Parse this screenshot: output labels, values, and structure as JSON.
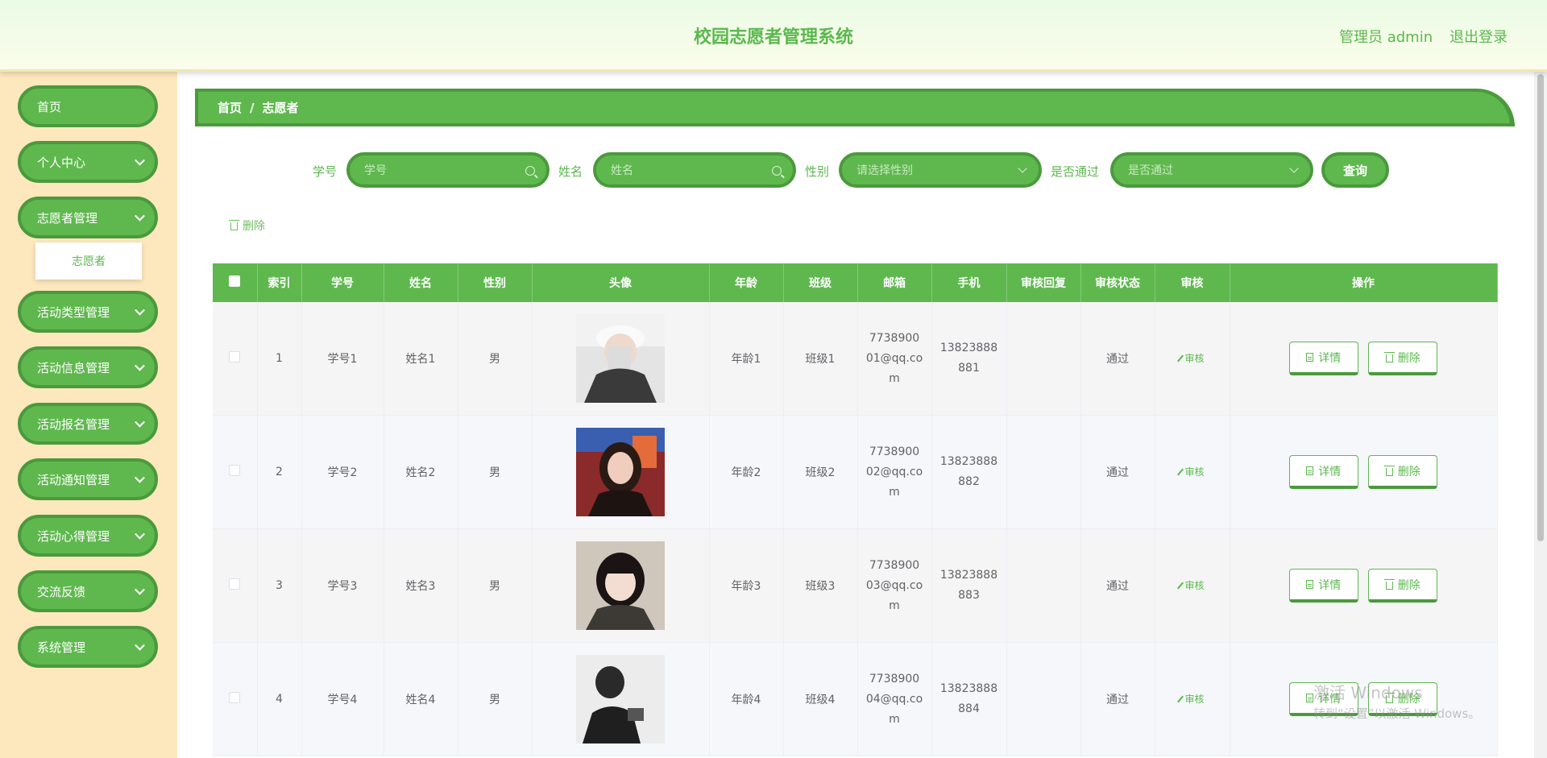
{
  "header": {
    "title": "校园志愿者管理系统",
    "user": "管理员 admin",
    "logout": "退出登录"
  },
  "sidebar": {
    "items": [
      {
        "label": "首页"
      },
      {
        "label": "个人中心"
      },
      {
        "label": "志愿者管理"
      },
      {
        "label": "活动类型管理"
      },
      {
        "label": "活动信息管理"
      },
      {
        "label": "活动报名管理"
      },
      {
        "label": "活动通知管理"
      },
      {
        "label": "活动心得管理"
      },
      {
        "label": "交流反馈"
      },
      {
        "label": "系统管理"
      }
    ],
    "submenu_active": "志愿者"
  },
  "breadcrumb": {
    "home": "首页",
    "sep": "/",
    "current": "志愿者"
  },
  "search": {
    "student_no_label": "学号",
    "student_no_placeholder": "学号",
    "name_label": "姓名",
    "name_placeholder": "姓名",
    "gender_label": "性别",
    "gender_placeholder": "请选择性别",
    "passed_label": "是否通过",
    "passed_placeholder": "是否通过",
    "query_button": "查询"
  },
  "actions": {
    "batch_delete": "删除"
  },
  "table": {
    "headers": [
      "索引",
      "学号",
      "姓名",
      "性别",
      "头像",
      "年龄",
      "班级",
      "邮箱",
      "手机",
      "审核回复",
      "审核状态",
      "审核",
      "操作"
    ],
    "rows": [
      {
        "index": "1",
        "student_no": "学号1",
        "name": "姓名1",
        "gender": "男",
        "age": "年龄1",
        "class": "班级1",
        "email": "773890001@qq.com",
        "phone": "13823888881",
        "reply": "",
        "status": "通过",
        "audit": "审核",
        "detail": "详情",
        "delete": "删除"
      },
      {
        "index": "2",
        "student_no": "学号2",
        "name": "姓名2",
        "gender": "男",
        "age": "年龄2",
        "class": "班级2",
        "email": "773890002@qq.com",
        "phone": "13823888882",
        "reply": "",
        "status": "通过",
        "audit": "审核",
        "detail": "详情",
        "delete": "删除"
      },
      {
        "index": "3",
        "student_no": "学号3",
        "name": "姓名3",
        "gender": "男",
        "age": "年龄3",
        "class": "班级3",
        "email": "773890003@qq.com",
        "phone": "13823888883",
        "reply": "",
        "status": "通过",
        "audit": "审核",
        "detail": "详情",
        "delete": "删除"
      },
      {
        "index": "4",
        "student_no": "学号4",
        "name": "姓名4",
        "gender": "男",
        "age": "年龄4",
        "class": "班级4",
        "email": "773890004@qq.com",
        "phone": "13823888884",
        "reply": "",
        "status": "通过",
        "audit": "审核",
        "detail": "详情",
        "delete": "删除"
      }
    ]
  },
  "watermark": {
    "line1": "激活 Windows",
    "line2": "转到“设置”以激活 Windows。"
  },
  "colors": {
    "primary": "#5fb84e",
    "primary_dark": "#4a9a3c",
    "sidebar_bg": "#fde7bd"
  }
}
